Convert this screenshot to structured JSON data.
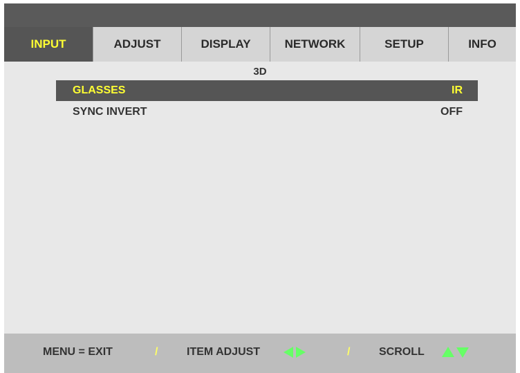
{
  "tabs": [
    {
      "label": "INPUT",
      "active": true
    },
    {
      "label": "ADJUST",
      "active": false
    },
    {
      "label": "DISPLAY",
      "active": false
    },
    {
      "label": "NETWORK",
      "active": false
    },
    {
      "label": "SETUP",
      "active": false
    },
    {
      "label": "INFO",
      "active": false
    }
  ],
  "section_title": "3D",
  "items": [
    {
      "label": "GLASSES",
      "value": "IR",
      "selected": true
    },
    {
      "label": "SYNC INVERT",
      "value": "OFF",
      "selected": false
    }
  ],
  "footer": {
    "exit_hint": "MENU = EXIT",
    "separator": "/",
    "adjust_hint": "ITEM ADJUST",
    "scroll_hint": "SCROLL",
    "adjust_icon_names": [
      "arrow-left-icon",
      "arrow-right-icon"
    ],
    "scroll_icon_names": [
      "arrow-up-icon",
      "arrow-down-icon"
    ]
  },
  "colors": {
    "active_text": "#ffff33",
    "active_bg": "#555555",
    "arrow_green": "#66ff66"
  }
}
